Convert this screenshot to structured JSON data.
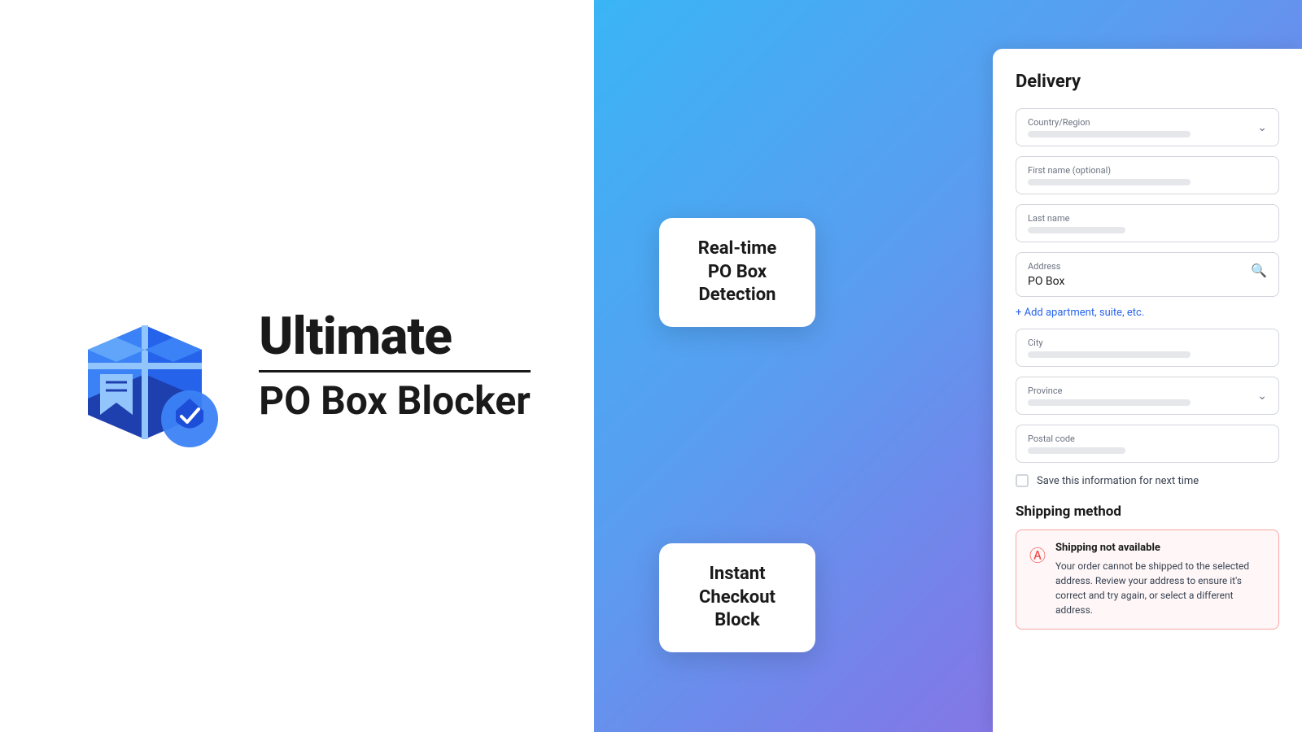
{
  "brand": {
    "title": "Ultimate",
    "divider": true,
    "subtitle": "PO Box Blocker"
  },
  "card_realtime": {
    "line1": "Real-time",
    "line2": "PO Box",
    "line3": "Detection"
  },
  "card_instant": {
    "line1": "Instant",
    "line2": "Checkout Block"
  },
  "delivery": {
    "title": "Delivery",
    "fields": {
      "country_label": "Country/Region",
      "first_name_label": "First name (optional)",
      "last_name_label": "Last name",
      "address_label": "Address",
      "address_value": "PO Box",
      "add_suite_text": "+ Add apartment, suite, etc.",
      "city_label": "City",
      "province_label": "Province",
      "postal_label": "Postal code",
      "save_info_label": "Save this information for next time"
    },
    "shipping_method": {
      "title": "Shipping method",
      "error_title": "Shipping not available",
      "error_body": "Your order cannot be shipped to the selected address. Review your address to ensure it's correct and try again, or select a different address."
    }
  }
}
